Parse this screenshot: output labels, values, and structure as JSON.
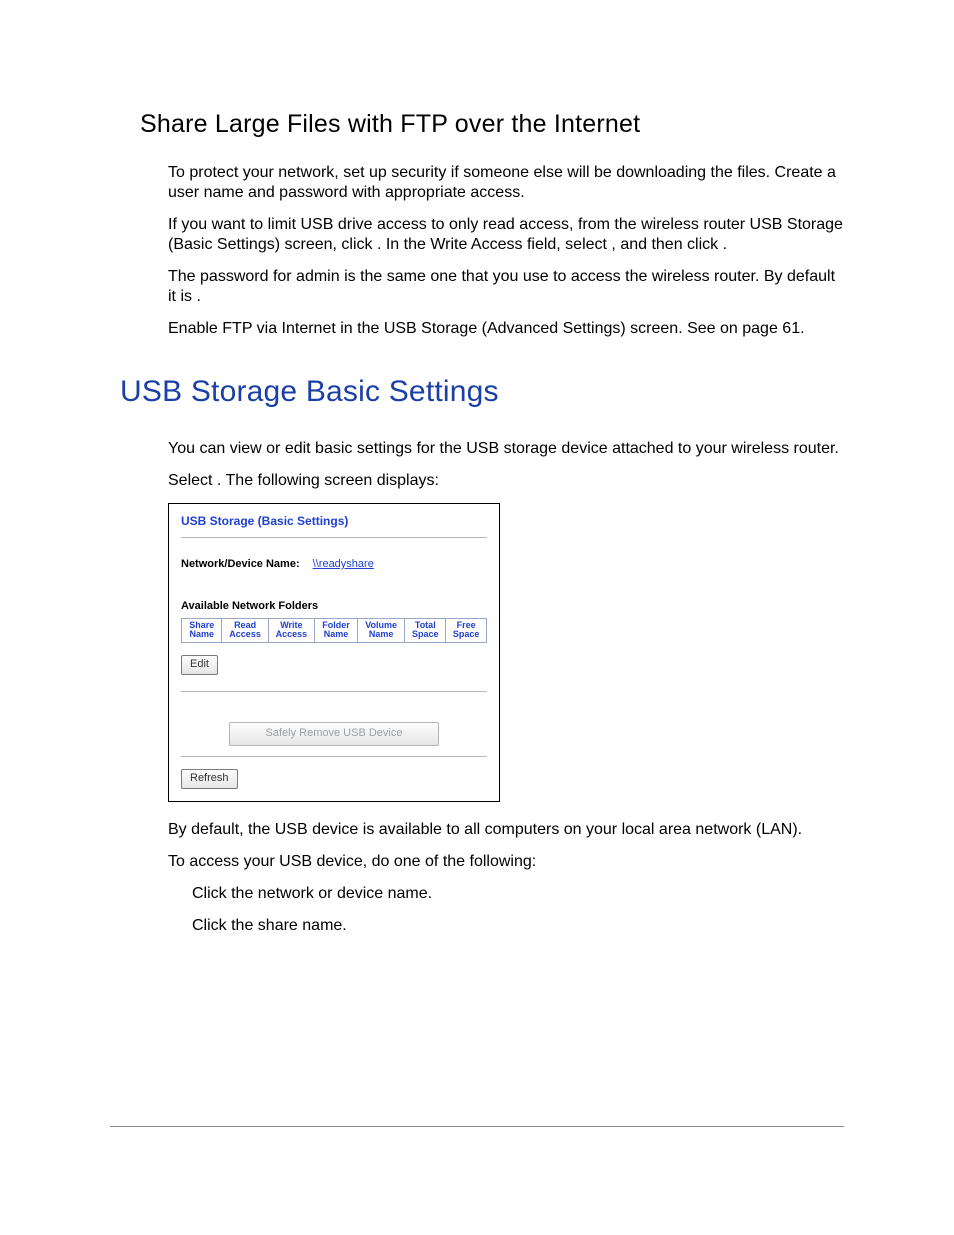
{
  "section1": {
    "heading": "Share Large Files with FTP over the Internet",
    "steps": [
      "To protect your network, set up security if someone else will be downloading the files. Create a user name and password with appropriate access.",
      "If you want to limit USB drive access to only read access, from the wireless router USB Storage (Basic Settings) screen, click         . In the Write Access field, select           , and then click           .",
      "The password for admin is the same one that you use to access the wireless router. By default it is                    .",
      "Enable FTP via Internet in the USB Storage (Advanced Settings) screen. See                                 on page 61."
    ]
  },
  "section2": {
    "heading": "USB Storage Basic Settings",
    "intro": "You can view or edit basic settings for the USB storage device attached to your wireless router.",
    "select_line": "Select                                                     . The following screen displays:",
    "after_shot": "By default, the USB device is available to all computers on your local area network (LAN).",
    "access_intro": "To access your USB device, do one of the following:",
    "access_items": [
      "Click the network or device name.",
      "Click the share name."
    ]
  },
  "screenshot": {
    "title": "USB Storage (Basic Settings)",
    "device_label": "Network/Device Name:",
    "device_link": "\\\\readyshare",
    "folders_heading": "Available Network Folders",
    "columns": [
      "Share Name",
      "Read Access",
      "Write Access",
      "Folder Name",
      "Volume Name",
      "Total Space",
      "Free Space"
    ],
    "buttons": {
      "edit": "Edit",
      "safely_remove": "Safely Remove USB Device",
      "refresh": "Refresh"
    }
  }
}
